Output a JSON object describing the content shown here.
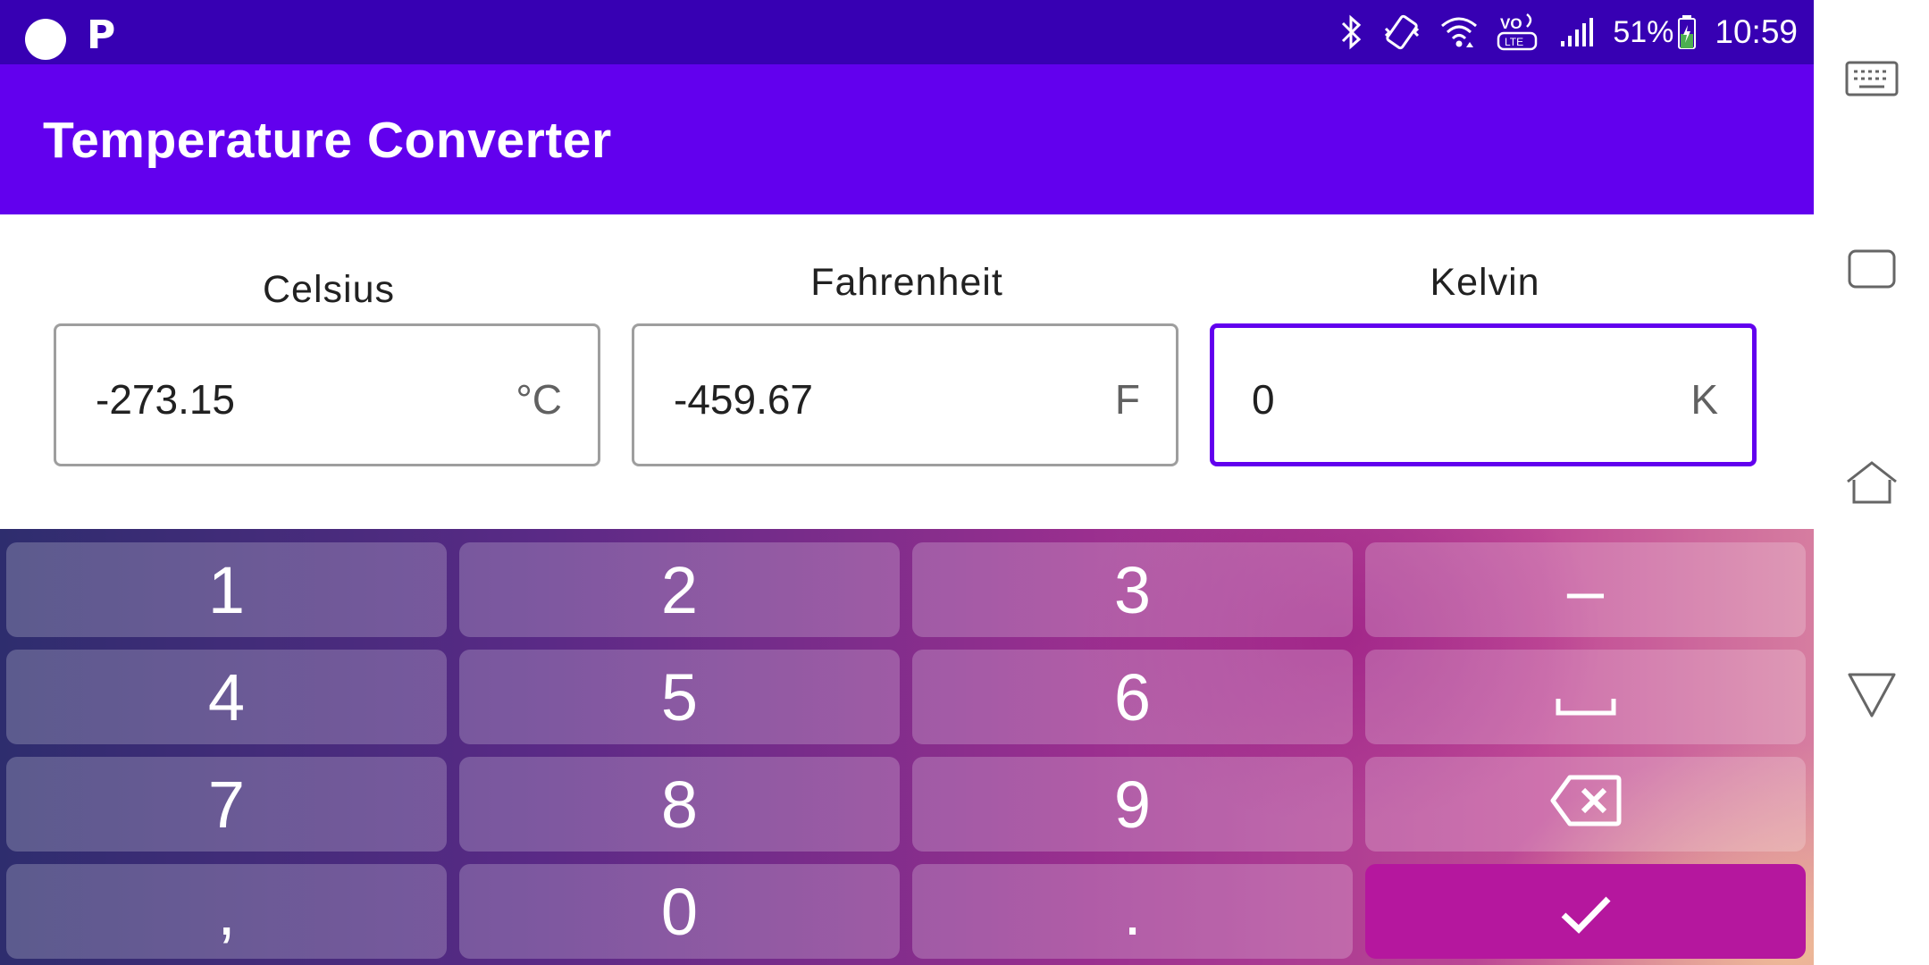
{
  "status_bar": {
    "notification_icons": [
      "circle-icon",
      "parking-icon"
    ],
    "p_glyph": "P",
    "system_icons": [
      "bluetooth-icon",
      "vibrate-icon",
      "wifi-icon",
      "volte-icon",
      "signal-icon"
    ],
    "volte_label": "VO LTE",
    "battery_percent": "51%",
    "battery_level": 0.51,
    "time": "10:59"
  },
  "app_bar": {
    "title": "Temperature Converter",
    "background": "#6200ee"
  },
  "converter": {
    "fields": [
      {
        "label": "Celsius",
        "value": "-273.15",
        "unit": "°C",
        "focused": false
      },
      {
        "label": "Fahrenheit",
        "value": "-459.67",
        "unit": "F",
        "focused": false
      },
      {
        "label": "Kelvin",
        "value": "0",
        "unit": "K",
        "focused": true
      }
    ]
  },
  "keyboard": {
    "rows": [
      [
        {
          "label": "1"
        },
        {
          "label": "2"
        },
        {
          "label": "3"
        },
        {
          "label": "–"
        }
      ],
      [
        {
          "label": "4"
        },
        {
          "label": "5"
        },
        {
          "label": "6"
        },
        {
          "icon": "space-icon"
        }
      ],
      [
        {
          "label": "7"
        },
        {
          "label": "8"
        },
        {
          "label": "9"
        },
        {
          "icon": "backspace-icon"
        }
      ],
      [
        {
          "label": ","
        },
        {
          "label": "0"
        },
        {
          "label": "."
        },
        {
          "icon": "check-icon"
        }
      ]
    ],
    "accent": "#b5179e"
  },
  "nav_bar": {
    "buttons": [
      "keyboard-icon",
      "recents-icon",
      "home-icon",
      "back-icon"
    ]
  }
}
